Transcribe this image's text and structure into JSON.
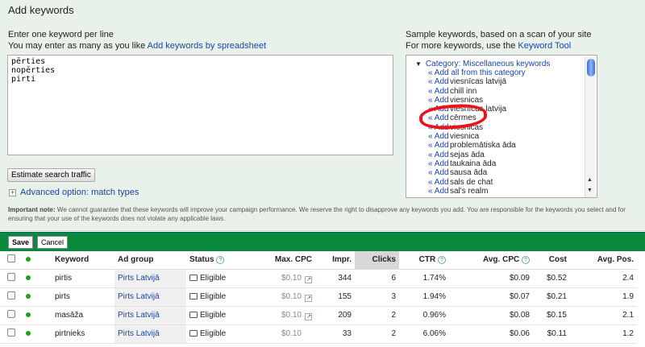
{
  "panel": {
    "title": "Add keywords",
    "instr1": "Enter one keyword per line",
    "instr2": "You may enter as many as you like",
    "spreadsheet_link": "Add keywords by spreadsheet",
    "keywords_text": "pērties\nnopērties\npirti",
    "estimate_button": "Estimate search traffic",
    "advanced_link": "Advanced option: match types"
  },
  "sample": {
    "line1": "Sample keywords, based on a scan of your site",
    "line2": "For more keywords, use the",
    "tool_link": "Keyword Tool",
    "category": "Category: Miscellaneous keywords",
    "add_all": "« Add all from this category",
    "add_label": "« Add",
    "items": [
      "viesnīcas latvijā",
      "chill inn",
      "viesnicas",
      "viesnīcas latvija",
      "cērmes",
      "viesnicas",
      "viesnica",
      "problemātiska āda",
      "sejas āda",
      "taukaina āda",
      "sausa āda",
      "sals de chat",
      "sal's realm"
    ]
  },
  "note": {
    "bold": "Important note:",
    "text": "We cannot guarantee that these keywords will improve your campaign performance. We reserve the right to disapprove any keywords you add. You are responsible for the keywords you select and for ensuring that your use of the keywords does not violate any applicable laws."
  },
  "actions": {
    "save": "Save",
    "cancel": "Cancel"
  },
  "table": {
    "headers": {
      "keyword": "Keyword",
      "ad_group": "Ad group",
      "status": "Status",
      "max_cpc": "Max. CPC",
      "impr": "Impr.",
      "clicks": "Clicks",
      "ctr": "CTR",
      "avg_cpc": "Avg. CPC",
      "cost": "Cost",
      "avg_pos": "Avg. Pos."
    },
    "rows": [
      {
        "keyword": "pirtis",
        "ad_group": "Pirts Latvijā",
        "status": "Eligible",
        "max_cpc": "$0.10",
        "impr": "344",
        "clicks": "6",
        "ctr": "1.74%",
        "avg_cpc": "$0.09",
        "cost": "$0.52",
        "avg_pos": "2.4"
      },
      {
        "keyword": "pirts",
        "ad_group": "Pirts Latvijā",
        "status": "Eligible",
        "max_cpc": "$0.10",
        "impr": "155",
        "clicks": "3",
        "ctr": "1.94%",
        "avg_cpc": "$0.07",
        "cost": "$0.21",
        "avg_pos": "1.9"
      },
      {
        "keyword": "masāža",
        "ad_group": "Pirts Latvijā",
        "status": "Eligible",
        "max_cpc": "$0.10",
        "impr": "209",
        "clicks": "2",
        "ctr": "0.96%",
        "avg_cpc": "$0.08",
        "cost": "$0.15",
        "avg_pos": "2.1"
      },
      {
        "keyword": "pirtnieks",
        "ad_group": "Pirts Latvijā",
        "status": "Eligible",
        "max_cpc": "$0.10",
        "impr": "33",
        "clicks": "2",
        "ctr": "6.06%",
        "avg_cpc": "$0.06",
        "cost": "$0.11",
        "avg_pos": "1.2"
      }
    ]
  }
}
